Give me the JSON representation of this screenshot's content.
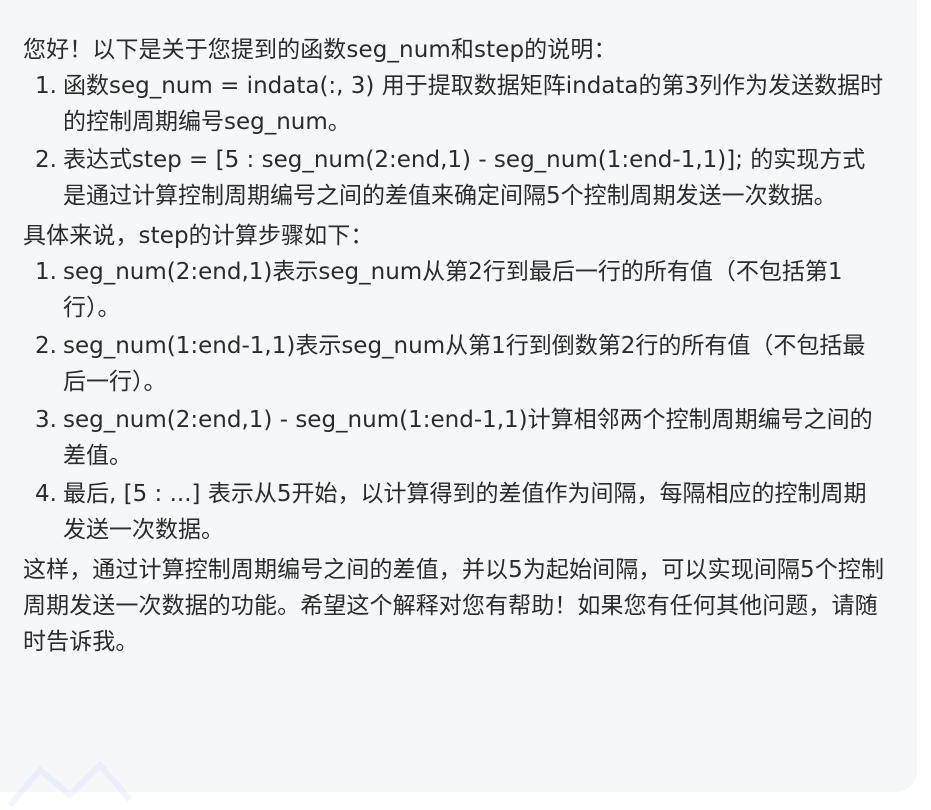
{
  "message": {
    "intro": "您好！以下是关于您提到的函数seg_num和step的说明：",
    "list1": [
      {
        "num": "1.",
        "text": "函数seg_num = indata(:, 3) 用于提取数据矩阵indata的第3列作为发送数据时的控制周期编号seg_num。"
      },
      {
        "num": "2.",
        "text": "表达式step = [5 : seg_num(2:end,1) - seg_num(1:end-1,1)]; 的实现方式是通过计算控制周期编号之间的差值来确定间隔5个控制周期发送一次数据。"
      }
    ],
    "mid": "具体来说，step的计算步骤如下：",
    "list2": [
      {
        "num": "1.",
        "text": "seg_num(2:end,1)表示seg_num从第2行到最后一行的所有值（不包括第1行）。"
      },
      {
        "num": "2.",
        "text": "seg_num(1:end-1,1)表示seg_num从第1行到倒数第2行的所有值（不包括最后一行）。"
      },
      {
        "num": "3.",
        "text": "seg_num(2:end,1) - seg_num(1:end-1,1)计算相邻两个控制周期编号之间的差值。"
      },
      {
        "num": "4.",
        "text": "最后, [5 : ...] 表示从5开始，以计算得到的差值作为间隔，每隔相应的控制周期发送一次数据。"
      }
    ],
    "conclusion": "这样，通过计算控制周期编号之间的差值，并以5为起始间隔，可以实现间隔5个控制周期发送一次数据的功能。希望这个解释对您有帮助！如果您有任何其他问题，请随时告诉我。"
  }
}
